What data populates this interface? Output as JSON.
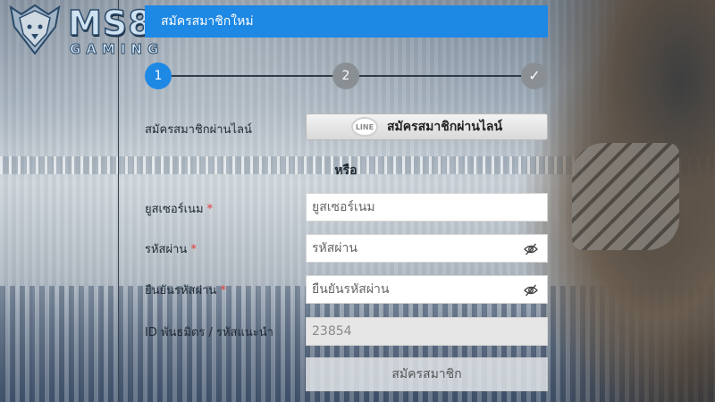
{
  "logo": {
    "main": "MS8",
    "sub": "GAMING"
  },
  "header": {
    "title": "สมัครสมาชิกใหม่"
  },
  "steps": [
    {
      "label": "1"
    },
    {
      "label": "2"
    },
    {
      "label": "✓"
    }
  ],
  "line_signup": {
    "label": "สมัครสมาชิกผ่านไลน์",
    "button_label": "สมัครสมาชิกผ่านไลน์",
    "icon_text": "LINE"
  },
  "or_text": "หรือ",
  "form": {
    "username": {
      "label": "ยูสเซอร์เนม",
      "required": "*",
      "placeholder": "ยูสเซอร์เนม"
    },
    "password": {
      "label": "รหัสผ่าน",
      "required": "*",
      "placeholder": "รหัสผ่าน"
    },
    "confirm_password": {
      "label": "ยืนยันรหัสผ่าน",
      "required": "*",
      "placeholder": "ยืนยันรหัสผ่าน"
    },
    "referral": {
      "label": "ID พันธมิตร / รหัสแนะนำ",
      "value": "23854"
    },
    "submit_label": "สมัครสมาชิก"
  },
  "colors": {
    "accent": "#1e88e5",
    "required": "#e53935",
    "step_inactive": "#8a8f94"
  }
}
